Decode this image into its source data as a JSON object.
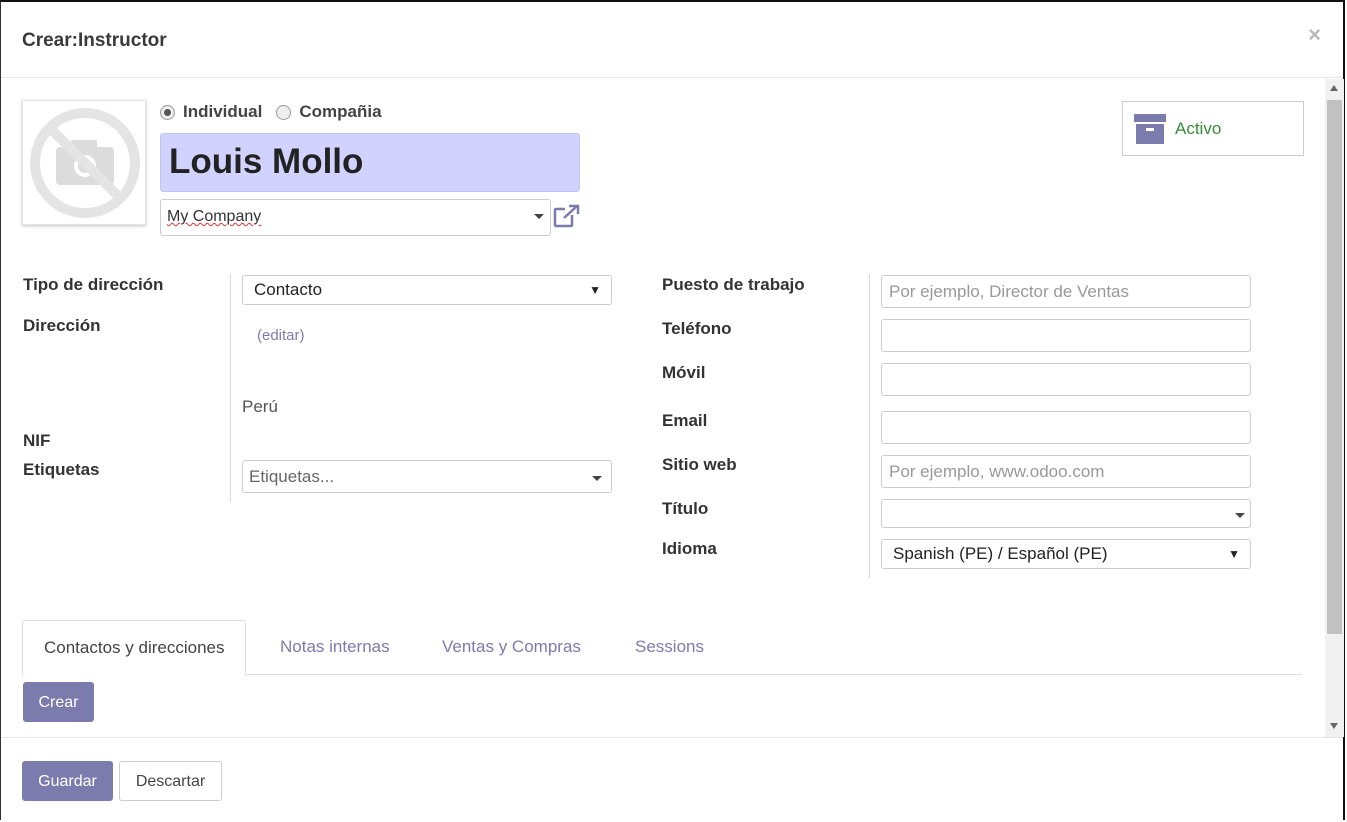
{
  "dialog": {
    "title": "Crear:Instructor",
    "close": "×"
  },
  "header": {
    "type_options": [
      {
        "label": "Individual",
        "checked": true
      },
      {
        "label": "Compañia",
        "checked": false
      }
    ],
    "name": "Louis Mollo",
    "company": "My Company",
    "active_label": "Activo"
  },
  "left_fields": {
    "address_type_label": "Tipo de dirección",
    "address_type_value": "Contacto",
    "address_label": "Dirección",
    "edit_link": "(editar)",
    "country": "Perú",
    "vat_label": "NIF",
    "tags_label": "Etiquetas",
    "tags_placeholder": "Etiquetas..."
  },
  "right_fields": {
    "job_label": "Puesto de trabajo",
    "job_placeholder": "Por ejemplo, Director de Ventas",
    "phone_label": "Teléfono",
    "mobile_label": "Móvil",
    "email_label": "Email",
    "website_label": "Sitio web",
    "website_placeholder": "Por ejemplo, www.odoo.com",
    "title_label": "Título",
    "lang_label": "Idioma",
    "lang_value": "Spanish (PE) / Español (PE)"
  },
  "tabs": [
    "Contactos y direcciones",
    "Notas internas",
    "Ventas y Compras",
    "Sessions"
  ],
  "tab_create_button": "Crear",
  "footer": {
    "save": "Guardar",
    "discard": "Descartar"
  },
  "colors": {
    "primary": "#7c7bad",
    "name_bg": "#d2d2ff",
    "active_text": "#3a8a3a"
  }
}
